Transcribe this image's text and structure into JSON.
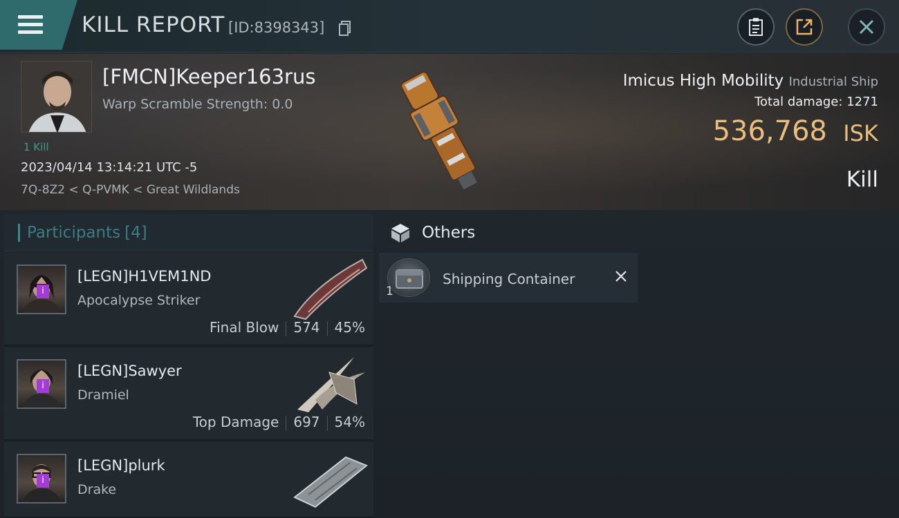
{
  "header": {
    "title": "KILL REPORT",
    "report_id": "[ID:8398343]",
    "icons": [
      "menu-icon",
      "copy-icon",
      "clipboard-icon",
      "share-icon",
      "close-icon"
    ]
  },
  "victim": {
    "name": "[FMCN]Keeper163rus",
    "warp_scramble": "Warp Scramble Strength: 0.0",
    "kills": "1 Kill",
    "timestamp": "2023/04/14 13:14:21 UTC -5",
    "location": "7Q-8Z2 < Q-PVMK < Great Wildlands"
  },
  "ship": {
    "name": "Imicus High Mobility",
    "class": "Industrial Ship",
    "total_damage_label": "Total damage:",
    "total_damage_value": "1271",
    "isk_value": "536,768",
    "isk_unit": "ISK",
    "result": "Kill"
  },
  "participants": {
    "label": "Participants",
    "count": "[4]",
    "items": [
      {
        "name": "[LEGN]H1VEM1ND",
        "ship": "Apocalypse Striker",
        "role": "Final Blow",
        "damage": "574",
        "percent": "45%"
      },
      {
        "name": "[LEGN]Sawyer",
        "ship": "Dramiel",
        "role": "Top Damage",
        "damage": "697",
        "percent": "54%"
      },
      {
        "name": "[LEGN]plurk",
        "ship": "Drake"
      }
    ]
  },
  "others": {
    "label": "Others",
    "items": [
      {
        "quantity": "1",
        "name": "Shipping Container"
      }
    ]
  },
  "colors": {
    "accent_teal": "#2f6a6c",
    "isk_gold": "#e8bf7c",
    "tag_purple": "#a23bd8"
  }
}
